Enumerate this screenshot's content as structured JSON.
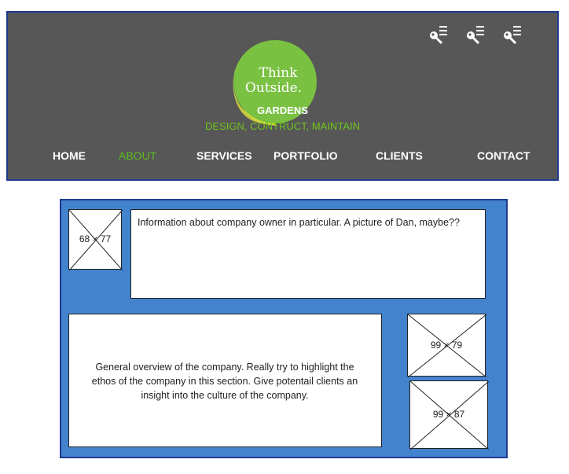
{
  "header": {
    "logo_line1": "Think",
    "logo_line2": "Outside.",
    "brand_name": "GARDENS",
    "brand_tagline": "DESIGN, CONTRUCT, MAINTAIN",
    "icons": [
      "key-list-icon",
      "key-list-icon",
      "key-list-icon"
    ],
    "nav": [
      {
        "label": "HOME"
      },
      {
        "label": "ABOUT",
        "active": true
      },
      {
        "label": "SERVICES"
      },
      {
        "label": "PORTFOLIO"
      },
      {
        "label": "CLIENTS"
      },
      {
        "label": "CONTACT"
      }
    ]
  },
  "content": {
    "owner_image_label": "68 × 77",
    "owner_text": "Information about company owner in particular. A picture of Dan, maybe??",
    "overview_text": "General overview of the company. Really try to highlight the ethos of the company in this section. Give potentail clients an insight into the culture of the company.",
    "image2_label": "99 × 79",
    "image3_label": "99 × 87"
  },
  "colors": {
    "header_bg": "#575757",
    "accent_green": "#5dbb1d",
    "content_bg": "#4382cc",
    "border_navy": "#1f3b8f"
  }
}
